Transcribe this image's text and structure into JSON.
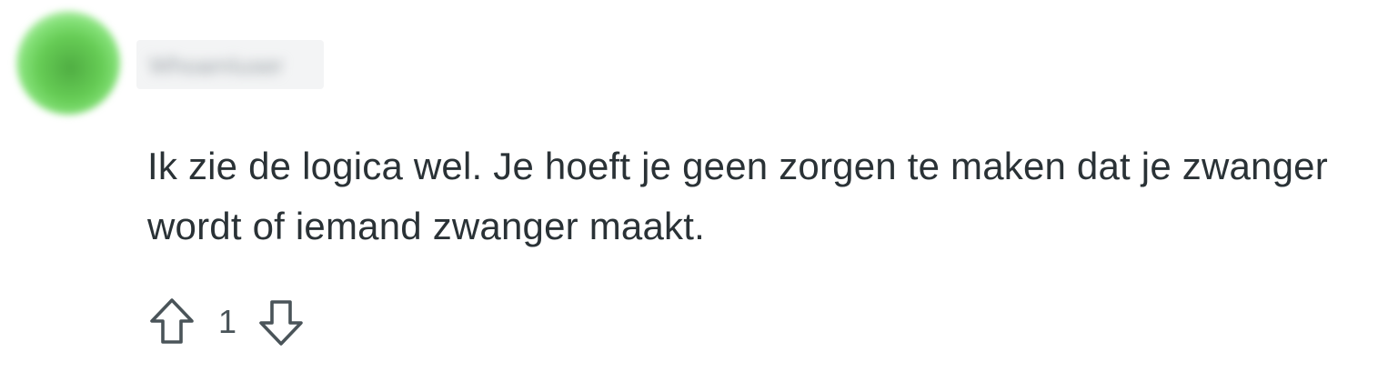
{
  "comment": {
    "author": {
      "username": "WhoamIuser",
      "avatar_color": "#5cbf4c"
    },
    "body": "Ik zie de logica wel. Je hoeft je geen zorgen te maken dat je zwanger wordt of iemand zwanger maakt.",
    "actions": {
      "upvote_icon": "arrow-up-outline-icon",
      "score": "1",
      "downvote_icon": "arrow-down-outline-icon"
    }
  }
}
